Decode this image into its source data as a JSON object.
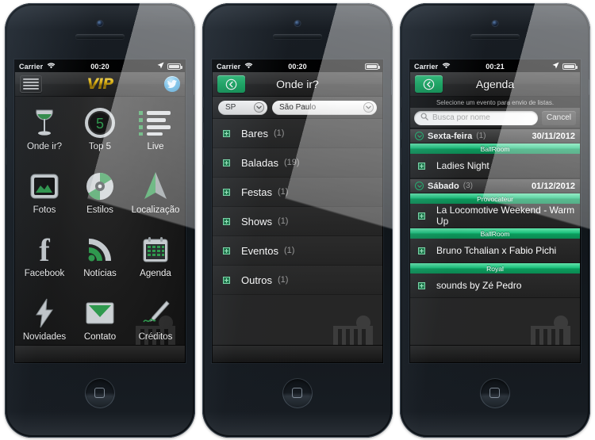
{
  "phones": [
    {
      "id": "phone-home",
      "statusbar": {
        "carrier": "Carrier",
        "time": "00:20",
        "wifi_icon": "wifi-icon",
        "location_icon": "location-arrow-icon",
        "battery_icon": "battery-icon"
      },
      "navbar": {
        "menu_icon": "hamburger-menu-icon",
        "logo": "VIP",
        "share_icon": "twitter-bird-icon"
      },
      "grid": [
        {
          "label": "Onde ir?",
          "icon": "cocktail-glass-icon"
        },
        {
          "label": "Top 5",
          "icon": "top5-badge-icon"
        },
        {
          "label": "Live",
          "icon": "live-list-icon"
        },
        {
          "label": "Fotos",
          "icon": "photo-frame-icon"
        },
        {
          "label": "Estilos",
          "icon": "music-disc-icon"
        },
        {
          "label": "Localização",
          "icon": "navigation-arrow-icon"
        },
        {
          "label": "Facebook",
          "icon": "facebook-icon"
        },
        {
          "label": "Notícias",
          "icon": "rss-feed-icon"
        },
        {
          "label": "Agenda",
          "icon": "calendar-icon"
        },
        {
          "label": "Novidades",
          "icon": "lightning-bolt-icon"
        },
        {
          "label": "Contato",
          "icon": "envelope-icon"
        },
        {
          "label": "Créditos",
          "icon": "pen-signature-icon"
        }
      ]
    },
    {
      "id": "phone-onde-ir",
      "statusbar": {
        "carrier": "Carrier",
        "time": "00:20",
        "wifi_icon": "wifi-icon",
        "battery_icon": "battery-icon"
      },
      "navbar": {
        "back_icon": "chevron-left-circle-icon",
        "title": "Onde ir?"
      },
      "selectors": {
        "state": {
          "value": "SP",
          "caret_icon": "chevron-down-circle-icon"
        },
        "city": {
          "value": "São Paulo",
          "caret_icon": "chevron-down-circle-icon"
        }
      },
      "categories": [
        {
          "name": "Bares",
          "count": "(1)"
        },
        {
          "name": "Baladas",
          "count": "(19)"
        },
        {
          "name": "Festas",
          "count": "(1)"
        },
        {
          "name": "Shows",
          "count": "(1)"
        },
        {
          "name": "Eventos",
          "count": "(1)"
        },
        {
          "name": "Outros",
          "count": "(1)"
        }
      ]
    },
    {
      "id": "phone-agenda",
      "statusbar": {
        "carrier": "Carrier",
        "time": "00:21",
        "wifi_icon": "wifi-icon",
        "location_icon": "location-arrow-icon",
        "battery_icon": "battery-icon"
      },
      "navbar": {
        "back_icon": "chevron-left-circle-icon",
        "title": "Agenda"
      },
      "subnote": "Selecione um evento para envio de listas.",
      "search": {
        "placeholder": "Busca por nome",
        "value": "",
        "search_icon": "magnifier-icon",
        "cancel_label": "Cancel"
      },
      "days": [
        {
          "weekday": "Sexta-feira",
          "count": "(1)",
          "date": "30/11/2012",
          "groups": [
            {
              "venue": "BallRoom",
              "events": [
                "Ladies Night"
              ]
            }
          ]
        },
        {
          "weekday": "Sábado",
          "count": "(3)",
          "date": "01/12/2012",
          "groups": [
            {
              "venue": "Provocateur",
              "events": [
                "La Locomotive Weekend - Warm Up"
              ]
            },
            {
              "venue": "BallRoom",
              "events": [
                "Bruno Tchalian x Fabio Pichi"
              ]
            },
            {
              "venue": "Royal",
              "events": [
                "sounds by Zé Pedro"
              ]
            }
          ]
        }
      ]
    }
  ],
  "colors": {
    "accent_green": "#12b873",
    "accent_green_dark": "#0a8a52",
    "gold": "#d9b313",
    "screen_bg": "#1b1b1b",
    "navbar_bg": "#2c2c2c",
    "twitter_blue": "#3aa5e0"
  }
}
